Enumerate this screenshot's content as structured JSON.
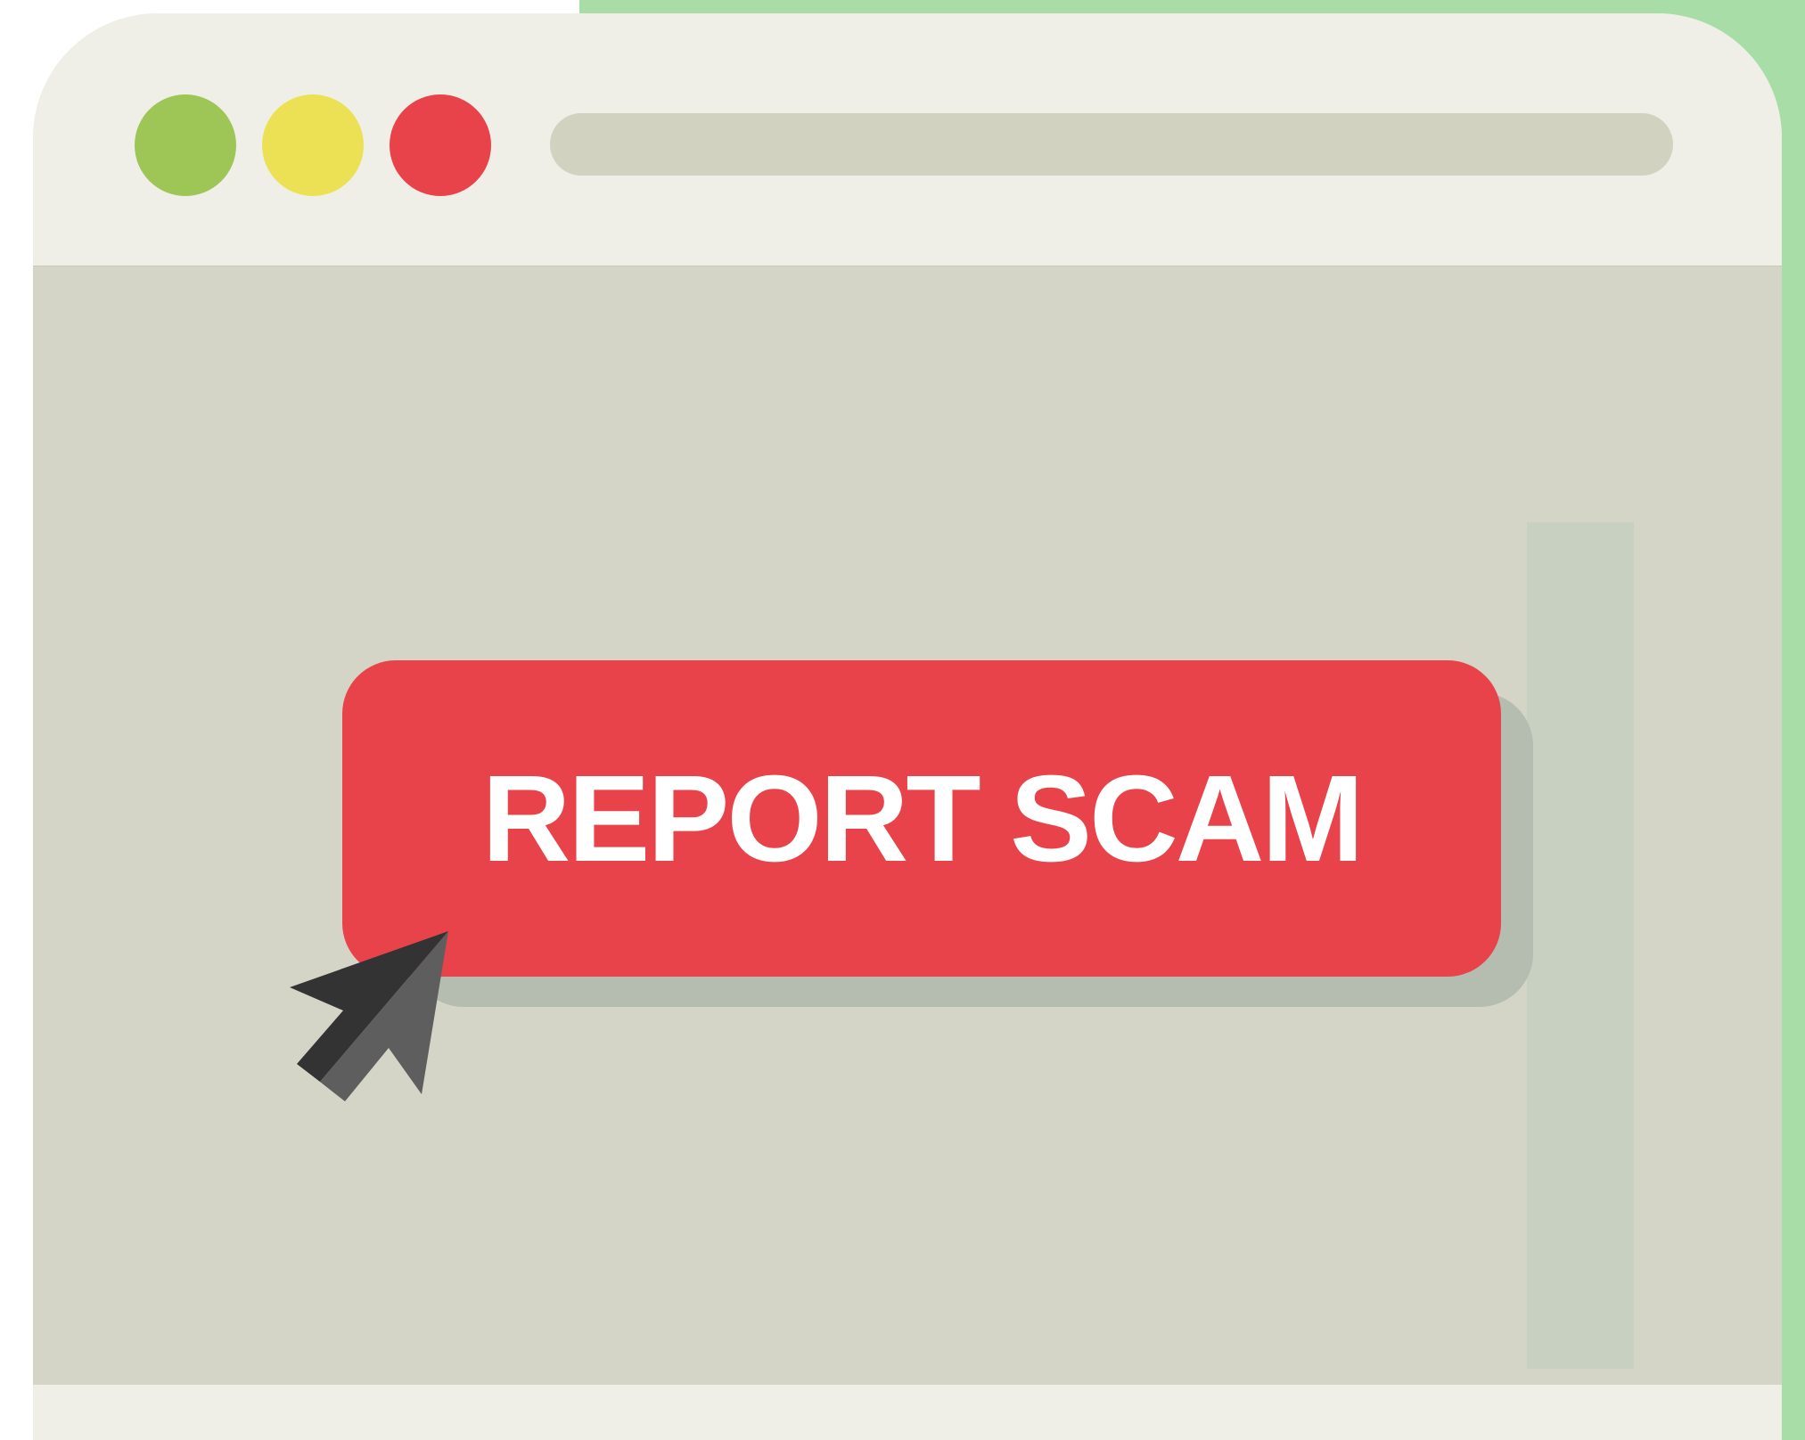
{
  "window": {
    "controls": [
      {
        "name": "green",
        "color": "#9dc657"
      },
      {
        "name": "yellow",
        "color": "#ece154"
      },
      {
        "name": "red",
        "color": "#e8434a"
      }
    ]
  },
  "button": {
    "label": "REPORT SCAM",
    "color": "#e8434a",
    "text_color": "#ffffff"
  },
  "cursor": {
    "icon": "mouse-pointer-icon"
  },
  "colors": {
    "accent": "#a8dda8",
    "chrome": "#efefe7",
    "content": "#d4d5c6"
  }
}
